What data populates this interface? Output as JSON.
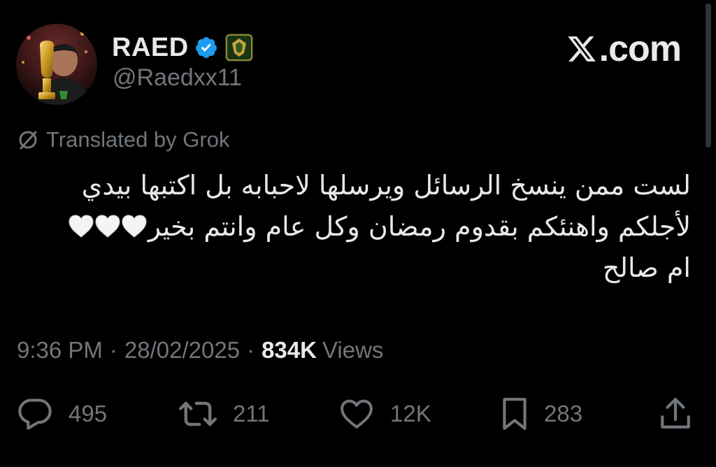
{
  "site": {
    "wordmark": ".com"
  },
  "author": {
    "display_name": "RAED",
    "handle": "@Raedxx11",
    "verified": true
  },
  "translation": {
    "label": "Translated by Grok"
  },
  "tweet": {
    "lines": [
      "لست ممن ينسخ الرسائل ويرسلها لاحبابه بل اكتبها بيدي",
      "لأجلكم واهنئكم بقدوم رمضان وكل عام وانتم بخير",
      "ام صالح"
    ]
  },
  "meta": {
    "time": "9:36 PM",
    "separator": "·",
    "date": "28/02/2025",
    "views_count": "834K",
    "views_label": "Views"
  },
  "actions": {
    "replies": "495",
    "reposts": "211",
    "likes": "12K",
    "bookmarks": "283"
  },
  "colors": {
    "background": "#000000",
    "text_primary": "#e7e9ea",
    "text_secondary": "#71767b",
    "verified_blue": "#1d9bf0"
  },
  "icons": {
    "verified": "verified-badge-icon",
    "affiliate": "affiliate-badge-icon",
    "translate": "translate-off-icon",
    "reply": "speech-bubble-icon",
    "repost": "repost-arrows-icon",
    "like": "heart-icon",
    "bookmark": "bookmark-icon",
    "share": "share-upload-icon",
    "emoji": "white-heart-emoji"
  }
}
